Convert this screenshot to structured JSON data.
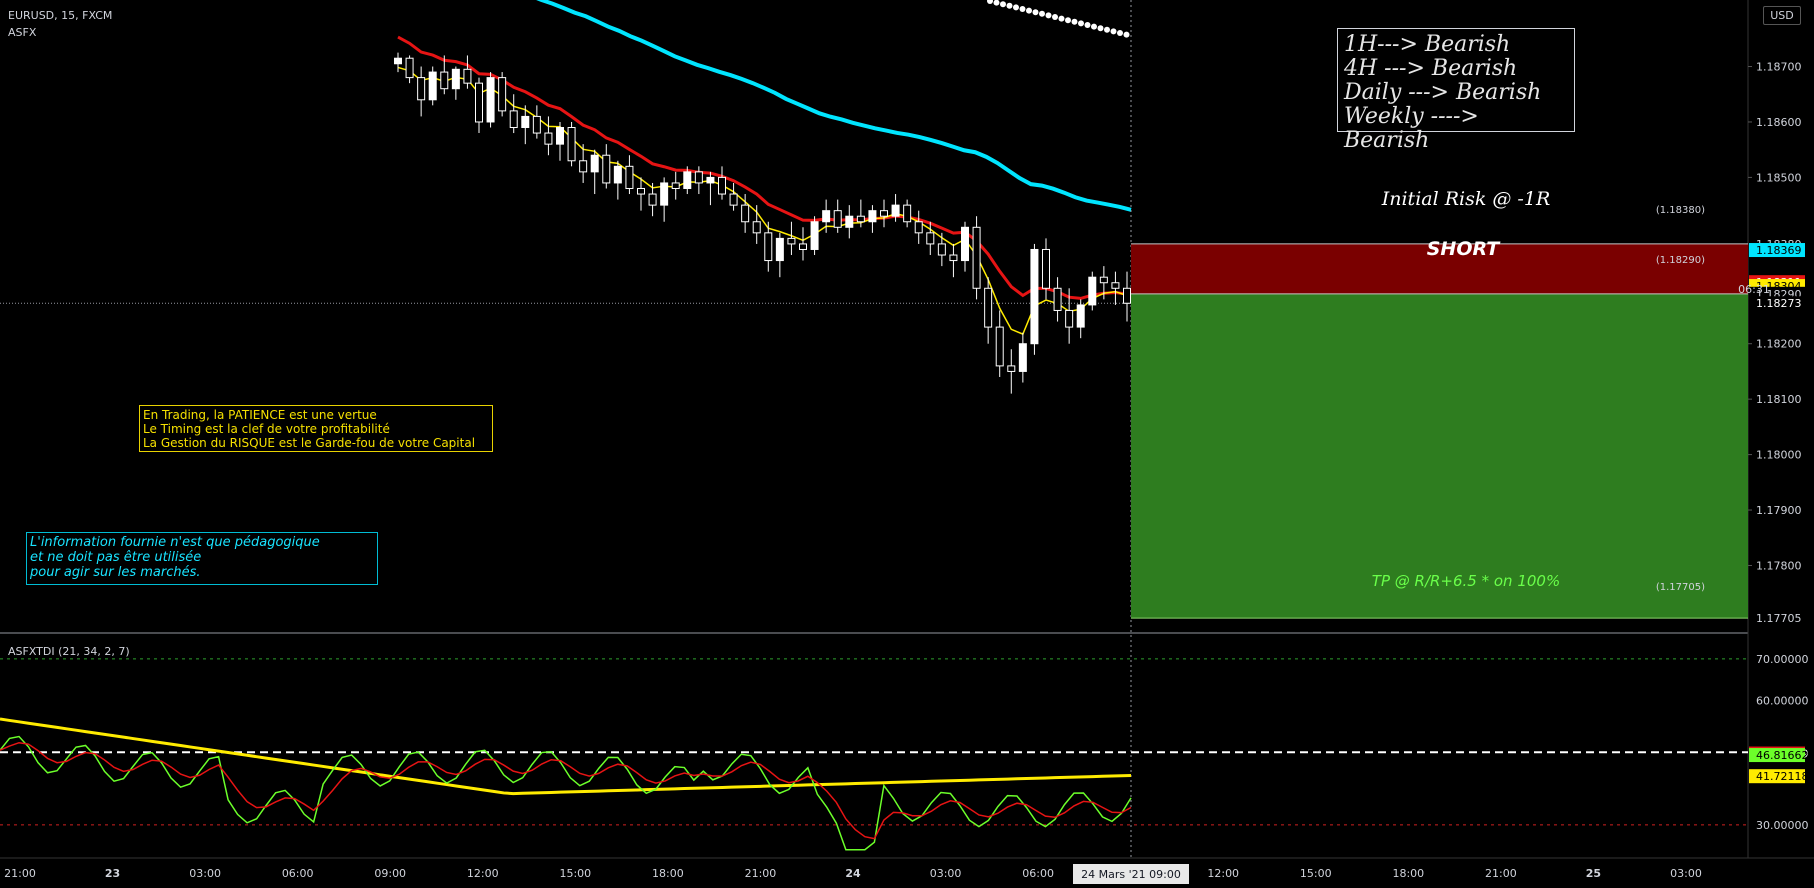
{
  "header": {
    "symbol": "EURUSD, 15, FXCM",
    "indicator": "ASFX"
  },
  "currency_button": "USD",
  "timeframe_box": {
    "lines": [
      "1H---> Bearish",
      "4H ---> Bearish",
      "Daily ---> Bearish",
      "Weekly ----> Bearish"
    ]
  },
  "motto_box": {
    "lines": [
      "En Trading, la PATIENCE est une vertue",
      "Le Timing est la clef de votre profitabilité",
      "La Gestion du RISQUE est le Garde-fou de votre Capital"
    ]
  },
  "disclaimer_box": {
    "lines": [
      "L'information fournie n'est que pédagogique",
      "et ne doit pas être utilisée",
      "pour agir sur les marchés."
    ]
  },
  "position": {
    "risk_label": "Initial Risk @ -1R",
    "direction_label": "SHORT",
    "tp_label": "TP @ R/R+6.5 * on 100%",
    "stop_price_label": "(1.18380)",
    "entry_price_label": "(1.18290)",
    "target_price_label": "(1.17705)",
    "stop": 1.1838,
    "entry": 1.1829,
    "target": 1.17705,
    "risk_color": "#7a0000",
    "reward_color": "#2e7d1f"
  },
  "price_axis": {
    "ticks": [
      {
        "v": 1.187,
        "t": "1.18700"
      },
      {
        "v": 1.186,
        "t": "1.18600"
      },
      {
        "v": 1.185,
        "t": "1.18500"
      },
      {
        "v": 1.182,
        "t": "1.18200"
      },
      {
        "v": 1.181,
        "t": "1.18100"
      },
      {
        "v": 1.18,
        "t": "1.18000"
      },
      {
        "v": 1.179,
        "t": "1.17900"
      },
      {
        "v": 1.178,
        "t": "1.17800"
      }
    ],
    "badges": [
      {
        "v": 1.1838,
        "t": "1.18380",
        "bg": "#000000",
        "fg": "#d1d4dc"
      },
      {
        "v": 1.18369,
        "t": "1.18369",
        "bg": "#00e5ff",
        "fg": "#000000"
      },
      {
        "v": 1.18311,
        "t": "1.18311",
        "bg": "#e61414",
        "fg": "#ffffff"
      },
      {
        "v": 1.18304,
        "t": "1.18304",
        "bg": "#ffeb00",
        "fg": "#000000"
      },
      {
        "v": 1.1829,
        "t": "1.18290",
        "bg": "#000000",
        "fg": "#d1d4dc"
      },
      {
        "v": 1.18273,
        "t": "1.18273",
        "bg": "#000000",
        "fg": "#ffffff"
      },
      {
        "v": 1.17705,
        "t": "1.17705",
        "bg": "#000000",
        "fg": "#d1d4dc"
      }
    ],
    "countdown": "06:31",
    "ylim": [
      1.1768,
      1.1882
    ]
  },
  "oscillator": {
    "title": "ASFXTDI (21, 34, 2, 7)",
    "ylim": [
      22,
      76
    ],
    "upper_level": 70,
    "mid_level": 47.5,
    "lower_level": 30,
    "ticks": [
      {
        "v": 70,
        "t": "70.00000"
      },
      {
        "v": 60,
        "t": "60.00000"
      },
      {
        "v": 30,
        "t": "30.00000"
      }
    ],
    "badges": [
      {
        "v": 47.18109,
        "t": "47.18109",
        "bg": "#e61414",
        "fg": "#ffffff"
      },
      {
        "v": 46.81662,
        "t": "46.81662",
        "bg": "#6cff2a",
        "fg": "#000000"
      },
      {
        "v": 41.72118,
        "t": "41.72118",
        "bg": "#ffeb00",
        "fg": "#000000"
      }
    ],
    "hidden_tick": "40.00000"
  },
  "time_axis": {
    "ticks": [
      "21:00",
      "23",
      "03:00",
      "06:00",
      "09:00",
      "12:00",
      "15:00",
      "18:00",
      "21:00",
      "24",
      "03:00",
      "06:00",
      "09:00",
      "12:00",
      "15:00",
      "18:00",
      "21:00",
      "25",
      "03:00"
    ],
    "cursor_label": "24 Mars '21"
  },
  "chart_data": {
    "type": "candlestick",
    "symbol": "EURUSD",
    "timeframe": "15",
    "price_range": [
      1.1768,
      1.1882
    ],
    "last_price": 1.18273,
    "moving_averages": [
      {
        "color": "#ffeb00",
        "last": 1.18304
      },
      {
        "color": "#e61414",
        "last": 1.18311
      },
      {
        "color": "#00e5ff",
        "last": 1.18369
      }
    ],
    "candles_ohlc": [
      [
        1.18705,
        1.18725,
        1.1869,
        1.18715
      ],
      [
        1.18715,
        1.1872,
        1.1867,
        1.1868
      ],
      [
        1.1868,
        1.187,
        1.1861,
        1.1864
      ],
      [
        1.1864,
        1.187,
        1.1863,
        1.1869
      ],
      [
        1.1869,
        1.1872,
        1.1865,
        1.1866
      ],
      [
        1.1866,
        1.187,
        1.1864,
        1.18695
      ],
      [
        1.18695,
        1.1872,
        1.1866,
        1.1867
      ],
      [
        1.1867,
        1.1868,
        1.1858,
        1.186
      ],
      [
        1.186,
        1.1869,
        1.1859,
        1.1868
      ],
      [
        1.1868,
        1.1869,
        1.1861,
        1.1862
      ],
      [
        1.1862,
        1.1865,
        1.1858,
        1.1859
      ],
      [
        1.1859,
        1.1863,
        1.1856,
        1.1861
      ],
      [
        1.1861,
        1.1863,
        1.1857,
        1.1858
      ],
      [
        1.1858,
        1.1861,
        1.1854,
        1.1856
      ],
      [
        1.1856,
        1.186,
        1.1853,
        1.1859
      ],
      [
        1.1859,
        1.186,
        1.1852,
        1.1853
      ],
      [
        1.1853,
        1.1856,
        1.1849,
        1.1851
      ],
      [
        1.1851,
        1.1855,
        1.1847,
        1.1854
      ],
      [
        1.1854,
        1.1856,
        1.1848,
        1.1849
      ],
      [
        1.1849,
        1.1853,
        1.1846,
        1.1852
      ],
      [
        1.1852,
        1.1854,
        1.1847,
        1.1848
      ],
      [
        1.1848,
        1.185,
        1.1844,
        1.1847
      ],
      [
        1.1847,
        1.1849,
        1.1843,
        1.1845
      ],
      [
        1.1845,
        1.185,
        1.1842,
        1.1849
      ],
      [
        1.1849,
        1.1851,
        1.1846,
        1.1848
      ],
      [
        1.1848,
        1.1852,
        1.1847,
        1.1851
      ],
      [
        1.1851,
        1.1852,
        1.1847,
        1.1849
      ],
      [
        1.1849,
        1.1851,
        1.1845,
        1.185
      ],
      [
        1.185,
        1.1852,
        1.1846,
        1.1847
      ],
      [
        1.1847,
        1.1849,
        1.1844,
        1.1845
      ],
      [
        1.1845,
        1.1847,
        1.184,
        1.1842
      ],
      [
        1.1842,
        1.1845,
        1.1838,
        1.184
      ],
      [
        1.184,
        1.1842,
        1.1833,
        1.1835
      ],
      [
        1.1835,
        1.184,
        1.1832,
        1.1839
      ],
      [
        1.1839,
        1.1842,
        1.1836,
        1.1838
      ],
      [
        1.1838,
        1.1841,
        1.1835,
        1.1837
      ],
      [
        1.1837,
        1.1843,
        1.1836,
        1.1842
      ],
      [
        1.1842,
        1.1846,
        1.184,
        1.1844
      ],
      [
        1.1844,
        1.1846,
        1.184,
        1.1841
      ],
      [
        1.1841,
        1.1845,
        1.1839,
        1.1843
      ],
      [
        1.1843,
        1.1846,
        1.1841,
        1.1842
      ],
      [
        1.1842,
        1.1845,
        1.184,
        1.1844
      ],
      [
        1.1844,
        1.1846,
        1.1841,
        1.1843
      ],
      [
        1.1843,
        1.1847,
        1.1842,
        1.1845
      ],
      [
        1.1845,
        1.1846,
        1.1841,
        1.1842
      ],
      [
        1.1842,
        1.1844,
        1.1838,
        1.184
      ],
      [
        1.184,
        1.1842,
        1.1836,
        1.1838
      ],
      [
        1.1838,
        1.184,
        1.1834,
        1.1836
      ],
      [
        1.1836,
        1.1838,
        1.1832,
        1.1835
      ],
      [
        1.1835,
        1.1842,
        1.1833,
        1.1841
      ],
      [
        1.1841,
        1.1843,
        1.1828,
        1.183
      ],
      [
        1.183,
        1.1832,
        1.182,
        1.1823
      ],
      [
        1.1823,
        1.1826,
        1.1814,
        1.1816
      ],
      [
        1.1816,
        1.1819,
        1.1811,
        1.1815
      ],
      [
        1.1815,
        1.1822,
        1.1813,
        1.182
      ],
      [
        1.182,
        1.1838,
        1.1818,
        1.1837
      ],
      [
        1.1837,
        1.1839,
        1.1828,
        1.183
      ],
      [
        1.183,
        1.1832,
        1.1824,
        1.1826
      ],
      [
        1.1826,
        1.183,
        1.182,
        1.1823
      ],
      [
        1.1823,
        1.1828,
        1.1821,
        1.1827
      ],
      [
        1.1827,
        1.1833,
        1.1826,
        1.1832
      ],
      [
        1.1832,
        1.1834,
        1.1828,
        1.1831
      ],
      [
        1.1831,
        1.1833,
        1.1827,
        1.183
      ],
      [
        1.183,
        1.1833,
        1.1824,
        1.18273
      ]
    ],
    "oscillator_series": [
      {
        "name": "",
        "color": "#6cff2a"
      },
      {
        "name": "",
        "color": "#e61414"
      },
      {
        "name": "",
        "color": "#ffeb00"
      }
    ]
  }
}
